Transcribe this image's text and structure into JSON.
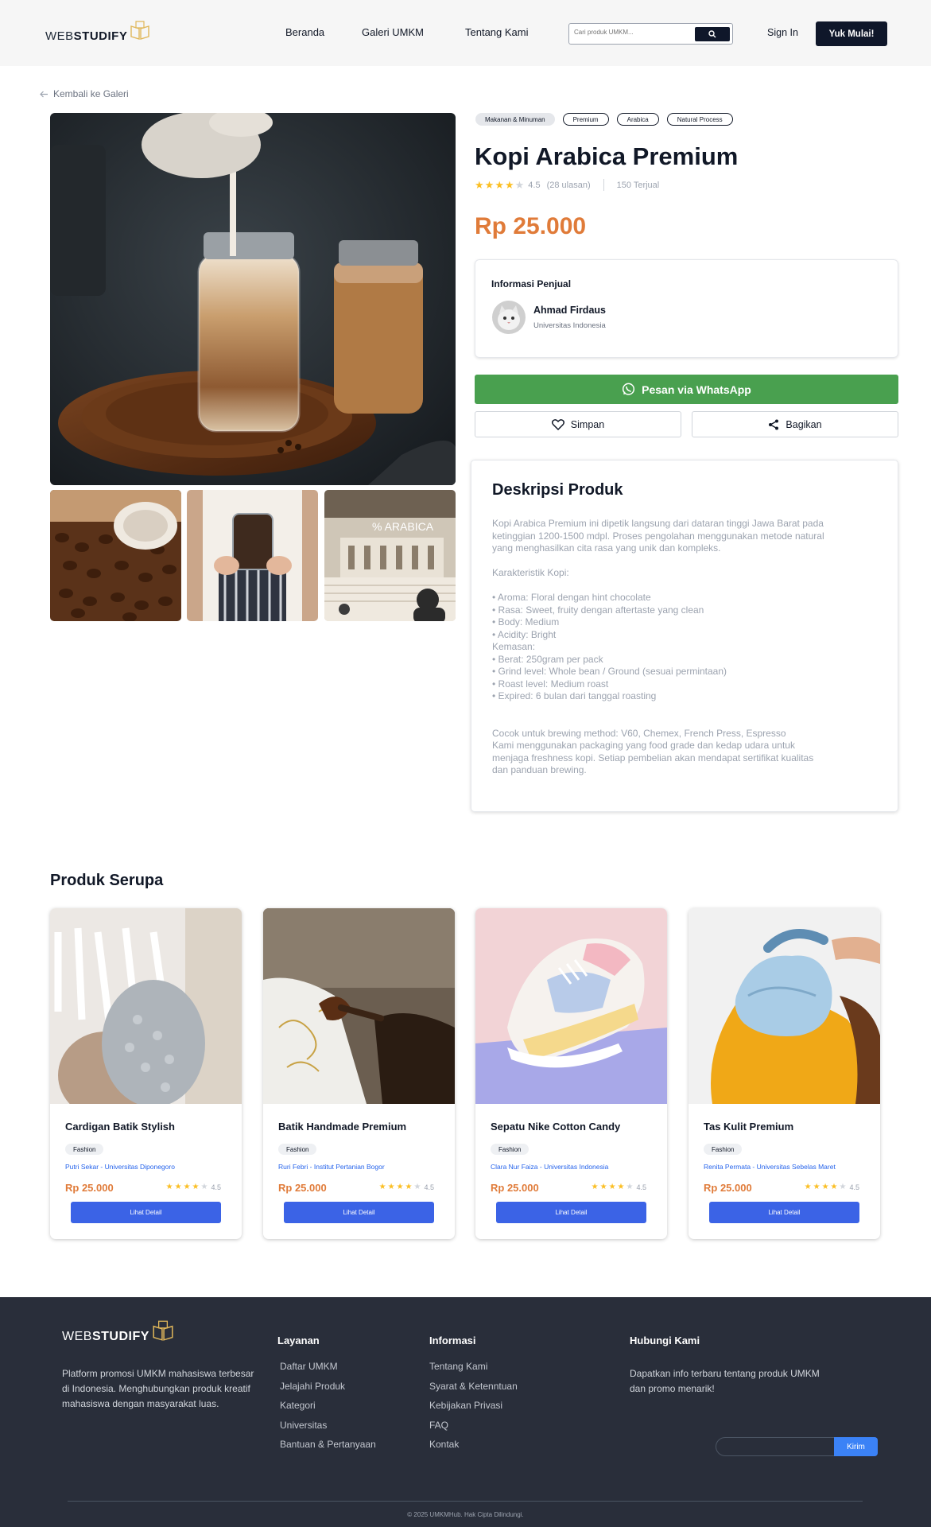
{
  "brand": {
    "web": "WEB",
    "studify": "STUDIFY"
  },
  "nav": {
    "links": [
      "Beranda",
      "Galeri UMKM",
      "Tentang Kami"
    ],
    "search_placeholder": "Cari produk UMKM...",
    "signin": "Sign In",
    "cta": "Yuk Mulai!"
  },
  "back_link": "Kembali ke Galeri",
  "product": {
    "tags": [
      "Makanan & Minuman",
      "Premium",
      "Arabica",
      "Natural Process"
    ],
    "title": "Kopi Arabica Premium",
    "rating": "4.5",
    "rating_value": 4.5,
    "reviews": "(28 ulasan)",
    "sold": "150 Terjual",
    "price": "Rp 25.000"
  },
  "seller": {
    "heading": "Informasi Penjual",
    "name": "Ahmad Firdaus",
    "university": "Universitas Indonesia"
  },
  "actions": {
    "whatsapp": "Pesan via WhatsApp",
    "save": "Simpan",
    "share": "Bagikan"
  },
  "description": {
    "title": "Deskripsi Produk",
    "lines": [
      "Kopi Arabica Premium ini dipetik langsung dari dataran tinggi Jawa Barat pada",
      "ketinggian 1200-1500 mdpl. Proses pengolahan menggunakan metode natural",
      "yang menghasilkan cita rasa yang unik dan kompleks.",
      "",
      "Karakteristik Kopi:",
      "",
      "• Aroma: Floral dengan hint chocolate",
      "• Rasa: Sweet, fruity dengan aftertaste yang clean",
      "• Body: Medium",
      "• Acidity: Bright",
      "Kemasan:",
      "• Berat: 250gram per pack",
      "• Grind level: Whole bean / Ground (sesuai permintaan)",
      "• Roast level: Medium roast",
      "• Expired: 6 bulan dari tanggal roasting",
      "",
      "",
      "Cocok untuk brewing method: V60, Chemex, French Press, Espresso",
      "Kami menggunakan packaging yang food grade dan kedap udara untuk",
      "menjaga freshness kopi. Setiap pembelian akan mendapat sertifikat kualitas",
      "dan panduan brewing."
    ]
  },
  "similar": {
    "title": "Produk Serupa",
    "items": [
      {
        "name": "Cardigan Batik Stylish",
        "category": "Fashion",
        "seller": "Putri Sekar - Universitas Diponegoro",
        "price": "Rp 25.000",
        "rating": "4.5",
        "button": "Lihat Detail"
      },
      {
        "name": "Batik Handmade Premium",
        "category": "Fashion",
        "seller": "Ruri Febri - Institut Pertanian Bogor",
        "price": "Rp 25.000",
        "rating": "4.5",
        "button": "Lihat Detail"
      },
      {
        "name": "Sepatu Nike Cotton Candy",
        "category": "Fashion",
        "seller": "Clara Nur Faiza - Universitas Indonesia",
        "price": "Rp 25.000",
        "rating": "4.5",
        "button": "Lihat Detail"
      },
      {
        "name": "Tas Kulit Premium",
        "category": "Fashion",
        "seller": "Renita Permata - Universitas Sebelas Maret",
        "price": "Rp 25.000",
        "rating": "4.5",
        "button": "Lihat Detail"
      }
    ]
  },
  "footer": {
    "about": "Platform promosi UMKM mahasiswa terbesar di Indonesia. Menghubungkan produk kreatif mahasiswa dengan masyarakat luas.",
    "services": {
      "title": "Layanan",
      "items": [
        "Daftar UMKM",
        "Jelajahi Produk",
        "Kategori",
        "Universitas",
        "Bantuan & Pertanyaan"
      ]
    },
    "info": {
      "title": "Informasi",
      "items": [
        "Tentang Kami",
        "Syarat & Ketenntuan",
        "Kebijakan Privasi",
        "FAQ",
        "Kontak"
      ]
    },
    "contact": {
      "title": "Hubungi Kami",
      "text": "Dapatkan info terbaru tentang produk UMKM dan promo menarik!",
      "submit": "Kirim"
    },
    "copyright": "© 2025 UMKMHub. Hak Cipta Dilindungi."
  },
  "colors": {
    "accent_price": "#e07b39",
    "primary_dark": "#0f172a",
    "whatsapp_green": "#49a04f",
    "button_blue": "#3b63e6",
    "footer_bg": "#292e3a",
    "star": "#fbbf24"
  }
}
